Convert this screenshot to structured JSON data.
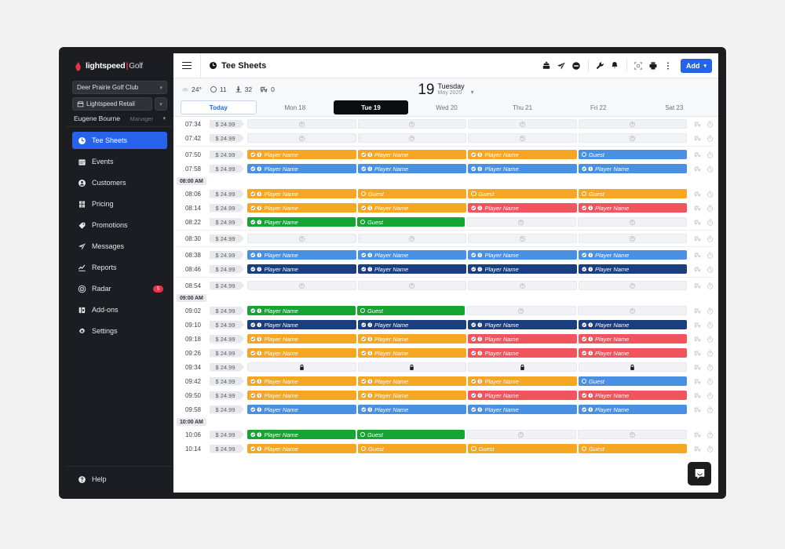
{
  "brand": {
    "name": "lightspeed",
    "separator": "|",
    "product": "Golf"
  },
  "sidebar": {
    "club_selector": {
      "label": "Deer Prairie Golf Club"
    },
    "app_selector": {
      "label": "Lightspeed Retail"
    },
    "user": {
      "name": "Eugene Bourne",
      "role": "Manager"
    },
    "items": [
      {
        "label": "Tee Sheets",
        "icon": "clock-icon",
        "active": true
      },
      {
        "label": "Events",
        "icon": "calendar-icon",
        "active": false
      },
      {
        "label": "Customers",
        "icon": "person-icon",
        "active": false
      },
      {
        "label": "Pricing",
        "icon": "tag-price-icon",
        "active": false
      },
      {
        "label": "Promotions",
        "icon": "promo-tag-icon",
        "active": false
      },
      {
        "label": "Messages",
        "icon": "paper-plane-icon",
        "active": false
      },
      {
        "label": "Reports",
        "icon": "chart-line-icon",
        "active": false
      },
      {
        "label": "Radar",
        "icon": "radar-icon",
        "active": false,
        "badge": "5"
      },
      {
        "label": "Add-ons",
        "icon": "puzzle-icon",
        "active": false
      },
      {
        "label": "Settings",
        "icon": "gear-icon",
        "active": false
      }
    ],
    "help": {
      "label": "Help",
      "icon": "help-icon"
    }
  },
  "topbar": {
    "menu_icon": "hamburger-icon",
    "page_title": "Tee Sheets",
    "page_icon": "clock-icon",
    "icons": [
      "cash-register-icon",
      "paper-plane-icon",
      "no-entry-icon",
      "wrench-icon",
      "bell-icon",
      "fullscreen-icon",
      "printer-icon",
      "more-vertical-icon"
    ],
    "add_button": {
      "label": "Add",
      "caret": "▾",
      "color": "#2563eb"
    }
  },
  "infobar": {
    "stats": [
      {
        "icon": "cloud-icon",
        "value": "24°"
      },
      {
        "icon": "circle-icon",
        "value": "11"
      },
      {
        "icon": "golfer-icon",
        "value": "32"
      },
      {
        "icon": "golf-cart-icon",
        "value": "0"
      }
    ],
    "date": {
      "day_number": "19",
      "weekday": "Tuesday",
      "month_year": "May 2020",
      "caret": "⌄"
    }
  },
  "day_tabs": [
    {
      "label": "Today",
      "style": "today"
    },
    {
      "label": "Mon 18",
      "style": "normal"
    },
    {
      "label": "Tue 19",
      "style": "selected"
    },
    {
      "label": "Wed 20",
      "style": "normal"
    },
    {
      "label": "Thu 21",
      "style": "normal"
    },
    {
      "label": "Fri 22",
      "style": "normal"
    },
    {
      "label": "Sat 23",
      "style": "normal"
    }
  ],
  "labels": {
    "player_name": "Player Name",
    "guest": "Guest",
    "plus": "+",
    "price": "$ 24.99"
  },
  "colors": {
    "orange": "#f5a623",
    "green": "#16a533",
    "blue_light": "#4a90e2",
    "blue_dark": "#1b3f7e",
    "red": "#f0545c",
    "accent": "#2563eb",
    "badge_red": "#e8344a"
  },
  "sheet": {
    "rows": [
      {
        "kind": "slot",
        "time": "07:34",
        "price": "$ 24.99",
        "slots": [
          {
            "t": "empty"
          },
          {
            "t": "empty"
          },
          {
            "t": "empty"
          },
          {
            "t": "empty"
          }
        ]
      },
      {
        "kind": "slot",
        "time": "07:42",
        "price": "$ 24.99",
        "slots": [
          {
            "t": "empty"
          },
          {
            "t": "empty"
          },
          {
            "t": "empty"
          },
          {
            "t": "empty"
          }
        ]
      },
      {
        "kind": "slot",
        "time": "07:50",
        "price": "$ 24.99",
        "slots": [
          {
            "t": "player",
            "c": "orange"
          },
          {
            "t": "player",
            "c": "orange"
          },
          {
            "t": "player",
            "c": "orange"
          },
          {
            "t": "guest",
            "c": "blue_light"
          }
        ]
      },
      {
        "kind": "slot",
        "time": "07:58",
        "price": "$ 24.99",
        "slots": [
          {
            "t": "player",
            "c": "blue_light"
          },
          {
            "t": "player",
            "c": "blue_light"
          },
          {
            "t": "player",
            "c": "blue_light"
          },
          {
            "t": "player",
            "c": "blue_light"
          }
        ]
      },
      {
        "kind": "hour",
        "label": "08:00 AM"
      },
      {
        "kind": "slot",
        "time": "08:06",
        "price": "$ 24.99",
        "slots": [
          {
            "t": "player",
            "c": "orange"
          },
          {
            "t": "guest",
            "c": "orange"
          },
          {
            "t": "guest",
            "c": "orange"
          },
          {
            "t": "guest",
            "c": "orange"
          }
        ]
      },
      {
        "kind": "slot",
        "time": "08:14",
        "price": "$ 24.99",
        "slots": [
          {
            "t": "player",
            "c": "orange"
          },
          {
            "t": "player",
            "c": "orange"
          },
          {
            "t": "player",
            "c": "red"
          },
          {
            "t": "player",
            "c": "red"
          }
        ]
      },
      {
        "kind": "slot",
        "time": "08:22",
        "price": "$ 24.99",
        "slots": [
          {
            "t": "player",
            "c": "green"
          },
          {
            "t": "guest",
            "c": "green"
          },
          {
            "t": "empty"
          },
          {
            "t": "empty"
          }
        ]
      },
      {
        "kind": "slot",
        "time": "08:30",
        "price": "$ 24.99",
        "slots": [
          {
            "t": "empty"
          },
          {
            "t": "empty"
          },
          {
            "t": "empty"
          },
          {
            "t": "empty"
          }
        ]
      },
      {
        "kind": "slot",
        "time": "08:38",
        "price": "$ 24.99",
        "slots": [
          {
            "t": "player",
            "c": "blue_light"
          },
          {
            "t": "player",
            "c": "blue_light"
          },
          {
            "t": "player",
            "c": "blue_light"
          },
          {
            "t": "player",
            "c": "blue_light"
          }
        ]
      },
      {
        "kind": "slot",
        "time": "08:46",
        "price": "$ 24.99",
        "slots": [
          {
            "t": "player",
            "c": "blue_dark"
          },
          {
            "t": "player",
            "c": "blue_dark"
          },
          {
            "t": "player",
            "c": "blue_dark"
          },
          {
            "t": "player",
            "c": "blue_dark"
          }
        ]
      },
      {
        "kind": "slot",
        "time": "08:54",
        "price": "$ 24.99",
        "slots": [
          {
            "t": "empty"
          },
          {
            "t": "empty"
          },
          {
            "t": "empty"
          },
          {
            "t": "empty"
          }
        ]
      },
      {
        "kind": "hour",
        "label": "09:00 AM"
      },
      {
        "kind": "slot",
        "time": "09:02",
        "price": "$ 24.99",
        "slots": [
          {
            "t": "player",
            "c": "green"
          },
          {
            "t": "guest",
            "c": "green"
          },
          {
            "t": "empty"
          },
          {
            "t": "empty"
          }
        ]
      },
      {
        "kind": "slot",
        "time": "09:10",
        "price": "$ 24.99",
        "slots": [
          {
            "t": "player",
            "c": "blue_dark"
          },
          {
            "t": "player",
            "c": "blue_dark"
          },
          {
            "t": "player",
            "c": "blue_dark"
          },
          {
            "t": "player",
            "c": "blue_dark"
          }
        ]
      },
      {
        "kind": "slot",
        "time": "09:18",
        "price": "$ 24.99",
        "slots": [
          {
            "t": "player",
            "c": "orange"
          },
          {
            "t": "player",
            "c": "orange"
          },
          {
            "t": "player",
            "c": "red"
          },
          {
            "t": "player",
            "c": "red"
          }
        ]
      },
      {
        "kind": "slot",
        "time": "09:26",
        "price": "$ 24.99",
        "slots": [
          {
            "t": "player",
            "c": "orange"
          },
          {
            "t": "player",
            "c": "orange"
          },
          {
            "t": "player",
            "c": "red"
          },
          {
            "t": "player",
            "c": "red"
          }
        ]
      },
      {
        "kind": "slot",
        "time": "09:34",
        "price": "$ 24.99",
        "slots": [
          {
            "t": "locked"
          },
          {
            "t": "locked"
          },
          {
            "t": "locked"
          },
          {
            "t": "locked"
          }
        ]
      },
      {
        "kind": "slot",
        "time": "09:42",
        "price": "$ 24.99",
        "slots": [
          {
            "t": "player",
            "c": "orange"
          },
          {
            "t": "player",
            "c": "orange"
          },
          {
            "t": "player",
            "c": "orange"
          },
          {
            "t": "guest",
            "c": "blue_light"
          }
        ]
      },
      {
        "kind": "slot",
        "time": "09:50",
        "price": "$ 24.99",
        "slots": [
          {
            "t": "player",
            "c": "orange"
          },
          {
            "t": "player",
            "c": "orange"
          },
          {
            "t": "player",
            "c": "red"
          },
          {
            "t": "player",
            "c": "red"
          }
        ]
      },
      {
        "kind": "slot",
        "time": "09:58",
        "price": "$ 24.99",
        "slots": [
          {
            "t": "player",
            "c": "blue_light"
          },
          {
            "t": "player",
            "c": "blue_light"
          },
          {
            "t": "player",
            "c": "blue_light"
          },
          {
            "t": "player",
            "c": "blue_light"
          }
        ]
      },
      {
        "kind": "hour",
        "label": "10:00 AM"
      },
      {
        "kind": "slot",
        "time": "10:06",
        "price": "$ 24.99",
        "slots": [
          {
            "t": "player",
            "c": "green"
          },
          {
            "t": "guest",
            "c": "green"
          },
          {
            "t": "empty"
          },
          {
            "t": "empty"
          }
        ]
      },
      {
        "kind": "slot",
        "time": "10:14",
        "price": "$ 24.99",
        "slots": [
          {
            "t": "player",
            "c": "orange"
          },
          {
            "t": "guest",
            "c": "orange"
          },
          {
            "t": "guest",
            "c": "orange"
          },
          {
            "t": "guest",
            "c": "orange"
          }
        ]
      }
    ],
    "row_icons": [
      "golf-cart-icon",
      "timer-icon"
    ]
  },
  "chat_widget": {
    "icon": "chat-bubble-icon"
  }
}
